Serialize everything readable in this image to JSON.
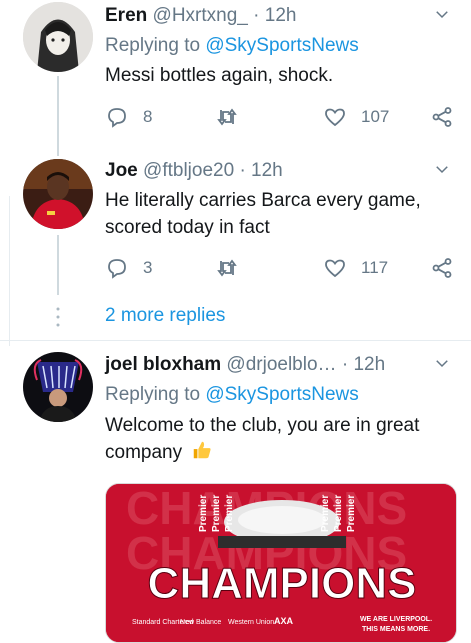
{
  "tweets": [
    {
      "name": "Eren",
      "handle": "@Hxrtxng_",
      "time": "12h",
      "replying_prefix": "Replying to ",
      "replying_to": "@SkySportsNews",
      "text": "Messi bottles again, shock.",
      "replies": "8",
      "retweets": "",
      "likes": "107"
    },
    {
      "name": "Joe",
      "handle": "@ftbljoe20",
      "time": "12h",
      "text": "He literally carries Barca every game, scored today in fact",
      "replies": "3",
      "retweets": "",
      "likes": "117"
    },
    {
      "name": "joel bloxham",
      "handle": "@drjoelblo…",
      "time": "12h",
      "replying_prefix": "Replying to ",
      "replying_to": "@SkySportsNews",
      "text": "Welcome to the club, you are in great company",
      "media": {
        "headline": "CHAMPIONS",
        "ribbon_word": "Premier",
        "footer_line1": "WE ARE LIVERPOOL.",
        "footer_line2": "THIS MEANS MORE.",
        "sponsors": [
          "Standard Chartered",
          "New Balance",
          "Western Union",
          "AXA"
        ]
      }
    }
  ],
  "more_replies": "2 more replies",
  "separator": "·",
  "colors": {
    "link": "#1b95e0",
    "muted": "#657786",
    "media_red": "#c8102e"
  }
}
